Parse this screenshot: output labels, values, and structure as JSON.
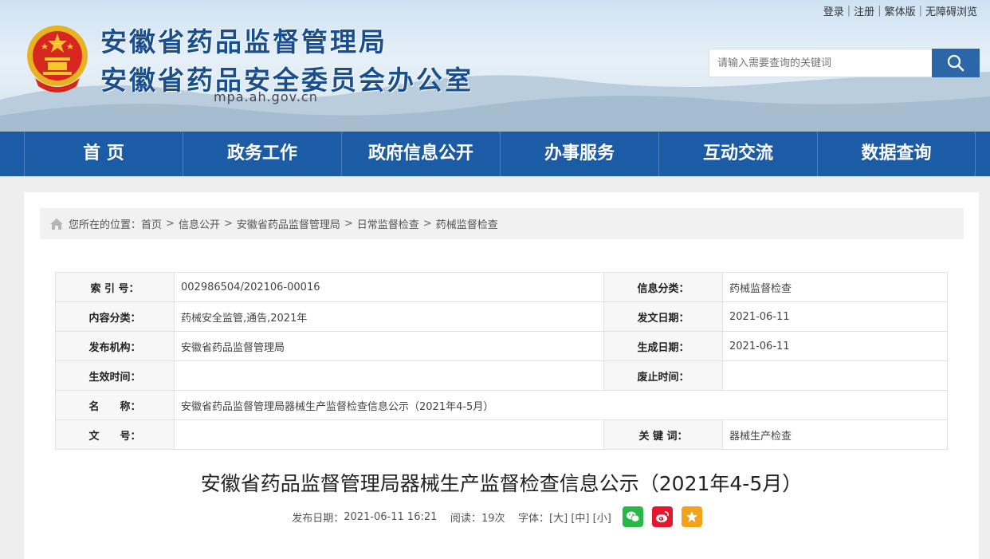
{
  "header": {
    "title1": "安徽省药品监督管理局",
    "title2": "安徽省药品安全委员会办公室",
    "domain": "mpa.ah.gov.cn"
  },
  "toplinks": {
    "login": "登录",
    "register": "注册",
    "traditional": "繁体版",
    "accessible": "无障碍浏览"
  },
  "search": {
    "placeholder": "请输入需要查询的关键词"
  },
  "nav": {
    "items": [
      "首 页",
      "政务工作",
      "政府信息公开",
      "办事服务",
      "互动交流",
      "数据查询"
    ]
  },
  "breadcrumb": {
    "prefix": "您所在的位置：",
    "items": [
      "首页",
      "信息公开",
      "安徽省药品监督管理局",
      "日常监督检查",
      "药械监督检查"
    ]
  },
  "meta": {
    "index_label": "索 引 号：",
    "index_value": "002986504/202106-00016",
    "category_label": "信息分类：",
    "category_value": "药械监督检查",
    "content_type_label": "内容分类：",
    "content_type_value": "药械安全监管,通告,2021年",
    "issue_date_label": "发文日期：",
    "issue_date_value": "2021-06-11",
    "publisher_label": "发布机构：",
    "publisher_value": "安徽省药品监督管理局",
    "generate_date_label": "生成日期：",
    "generate_date_value": "2021-06-11",
    "effective_label": "生效时间：",
    "effective_value": "",
    "repeal_label": "废止时间：",
    "repeal_value": "",
    "name_label": "名　　称：",
    "name_value": "安徽省药品监督管理局器械生产监督检查信息公示（2021年4-5月）",
    "docno_label": "文　　号：",
    "docno_value": "",
    "keyword_label": "关 键 词：",
    "keyword_value": "器械生产检查"
  },
  "article": {
    "title": "安徽省药品监督管理局器械生产监督检查信息公示（2021年4-5月）",
    "publish_label": "发布日期：",
    "publish_value": "2021-06-11 16:21",
    "views_label": "阅读：",
    "views_value": "19次",
    "font_label": "字体：",
    "font_large": "[大]",
    "font_medium": "[中]",
    "font_small": "[小]"
  },
  "colors": {
    "nav_bg": "#1c5ba6",
    "title_blue": "#1a4f8f",
    "search_btn": "#2a66a8"
  }
}
